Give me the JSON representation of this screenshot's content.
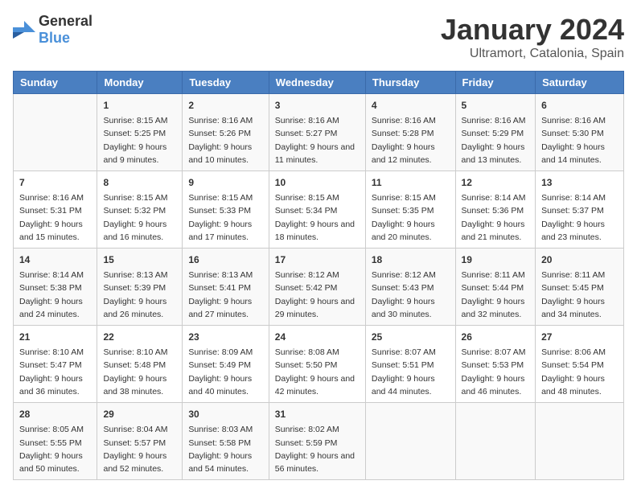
{
  "logo": {
    "text_general": "General",
    "text_blue": "Blue"
  },
  "title": "January 2024",
  "subtitle": "Ultramort, Catalonia, Spain",
  "days_header": [
    "Sunday",
    "Monday",
    "Tuesday",
    "Wednesday",
    "Thursday",
    "Friday",
    "Saturday"
  ],
  "weeks": [
    [
      {
        "num": "",
        "sunrise": "",
        "sunset": "",
        "daylight": ""
      },
      {
        "num": "1",
        "sunrise": "Sunrise: 8:15 AM",
        "sunset": "Sunset: 5:25 PM",
        "daylight": "Daylight: 9 hours and 9 minutes."
      },
      {
        "num": "2",
        "sunrise": "Sunrise: 8:16 AM",
        "sunset": "Sunset: 5:26 PM",
        "daylight": "Daylight: 9 hours and 10 minutes."
      },
      {
        "num": "3",
        "sunrise": "Sunrise: 8:16 AM",
        "sunset": "Sunset: 5:27 PM",
        "daylight": "Daylight: 9 hours and 11 minutes."
      },
      {
        "num": "4",
        "sunrise": "Sunrise: 8:16 AM",
        "sunset": "Sunset: 5:28 PM",
        "daylight": "Daylight: 9 hours and 12 minutes."
      },
      {
        "num": "5",
        "sunrise": "Sunrise: 8:16 AM",
        "sunset": "Sunset: 5:29 PM",
        "daylight": "Daylight: 9 hours and 13 minutes."
      },
      {
        "num": "6",
        "sunrise": "Sunrise: 8:16 AM",
        "sunset": "Sunset: 5:30 PM",
        "daylight": "Daylight: 9 hours and 14 minutes."
      }
    ],
    [
      {
        "num": "7",
        "sunrise": "Sunrise: 8:16 AM",
        "sunset": "Sunset: 5:31 PM",
        "daylight": "Daylight: 9 hours and 15 minutes."
      },
      {
        "num": "8",
        "sunrise": "Sunrise: 8:15 AM",
        "sunset": "Sunset: 5:32 PM",
        "daylight": "Daylight: 9 hours and 16 minutes."
      },
      {
        "num": "9",
        "sunrise": "Sunrise: 8:15 AM",
        "sunset": "Sunset: 5:33 PM",
        "daylight": "Daylight: 9 hours and 17 minutes."
      },
      {
        "num": "10",
        "sunrise": "Sunrise: 8:15 AM",
        "sunset": "Sunset: 5:34 PM",
        "daylight": "Daylight: 9 hours and 18 minutes."
      },
      {
        "num": "11",
        "sunrise": "Sunrise: 8:15 AM",
        "sunset": "Sunset: 5:35 PM",
        "daylight": "Daylight: 9 hours and 20 minutes."
      },
      {
        "num": "12",
        "sunrise": "Sunrise: 8:14 AM",
        "sunset": "Sunset: 5:36 PM",
        "daylight": "Daylight: 9 hours and 21 minutes."
      },
      {
        "num": "13",
        "sunrise": "Sunrise: 8:14 AM",
        "sunset": "Sunset: 5:37 PM",
        "daylight": "Daylight: 9 hours and 23 minutes."
      }
    ],
    [
      {
        "num": "14",
        "sunrise": "Sunrise: 8:14 AM",
        "sunset": "Sunset: 5:38 PM",
        "daylight": "Daylight: 9 hours and 24 minutes."
      },
      {
        "num": "15",
        "sunrise": "Sunrise: 8:13 AM",
        "sunset": "Sunset: 5:39 PM",
        "daylight": "Daylight: 9 hours and 26 minutes."
      },
      {
        "num": "16",
        "sunrise": "Sunrise: 8:13 AM",
        "sunset": "Sunset: 5:41 PM",
        "daylight": "Daylight: 9 hours and 27 minutes."
      },
      {
        "num": "17",
        "sunrise": "Sunrise: 8:12 AM",
        "sunset": "Sunset: 5:42 PM",
        "daylight": "Daylight: 9 hours and 29 minutes."
      },
      {
        "num": "18",
        "sunrise": "Sunrise: 8:12 AM",
        "sunset": "Sunset: 5:43 PM",
        "daylight": "Daylight: 9 hours and 30 minutes."
      },
      {
        "num": "19",
        "sunrise": "Sunrise: 8:11 AM",
        "sunset": "Sunset: 5:44 PM",
        "daylight": "Daylight: 9 hours and 32 minutes."
      },
      {
        "num": "20",
        "sunrise": "Sunrise: 8:11 AM",
        "sunset": "Sunset: 5:45 PM",
        "daylight": "Daylight: 9 hours and 34 minutes."
      }
    ],
    [
      {
        "num": "21",
        "sunrise": "Sunrise: 8:10 AM",
        "sunset": "Sunset: 5:47 PM",
        "daylight": "Daylight: 9 hours and 36 minutes."
      },
      {
        "num": "22",
        "sunrise": "Sunrise: 8:10 AM",
        "sunset": "Sunset: 5:48 PM",
        "daylight": "Daylight: 9 hours and 38 minutes."
      },
      {
        "num": "23",
        "sunrise": "Sunrise: 8:09 AM",
        "sunset": "Sunset: 5:49 PM",
        "daylight": "Daylight: 9 hours and 40 minutes."
      },
      {
        "num": "24",
        "sunrise": "Sunrise: 8:08 AM",
        "sunset": "Sunset: 5:50 PM",
        "daylight": "Daylight: 9 hours and 42 minutes."
      },
      {
        "num": "25",
        "sunrise": "Sunrise: 8:07 AM",
        "sunset": "Sunset: 5:51 PM",
        "daylight": "Daylight: 9 hours and 44 minutes."
      },
      {
        "num": "26",
        "sunrise": "Sunrise: 8:07 AM",
        "sunset": "Sunset: 5:53 PM",
        "daylight": "Daylight: 9 hours and 46 minutes."
      },
      {
        "num": "27",
        "sunrise": "Sunrise: 8:06 AM",
        "sunset": "Sunset: 5:54 PM",
        "daylight": "Daylight: 9 hours and 48 minutes."
      }
    ],
    [
      {
        "num": "28",
        "sunrise": "Sunrise: 8:05 AM",
        "sunset": "Sunset: 5:55 PM",
        "daylight": "Daylight: 9 hours and 50 minutes."
      },
      {
        "num": "29",
        "sunrise": "Sunrise: 8:04 AM",
        "sunset": "Sunset: 5:57 PM",
        "daylight": "Daylight: 9 hours and 52 minutes."
      },
      {
        "num": "30",
        "sunrise": "Sunrise: 8:03 AM",
        "sunset": "Sunset: 5:58 PM",
        "daylight": "Daylight: 9 hours and 54 minutes."
      },
      {
        "num": "31",
        "sunrise": "Sunrise: 8:02 AM",
        "sunset": "Sunset: 5:59 PM",
        "daylight": "Daylight: 9 hours and 56 minutes."
      },
      {
        "num": "",
        "sunrise": "",
        "sunset": "",
        "daylight": ""
      },
      {
        "num": "",
        "sunrise": "",
        "sunset": "",
        "daylight": ""
      },
      {
        "num": "",
        "sunrise": "",
        "sunset": "",
        "daylight": ""
      }
    ]
  ]
}
